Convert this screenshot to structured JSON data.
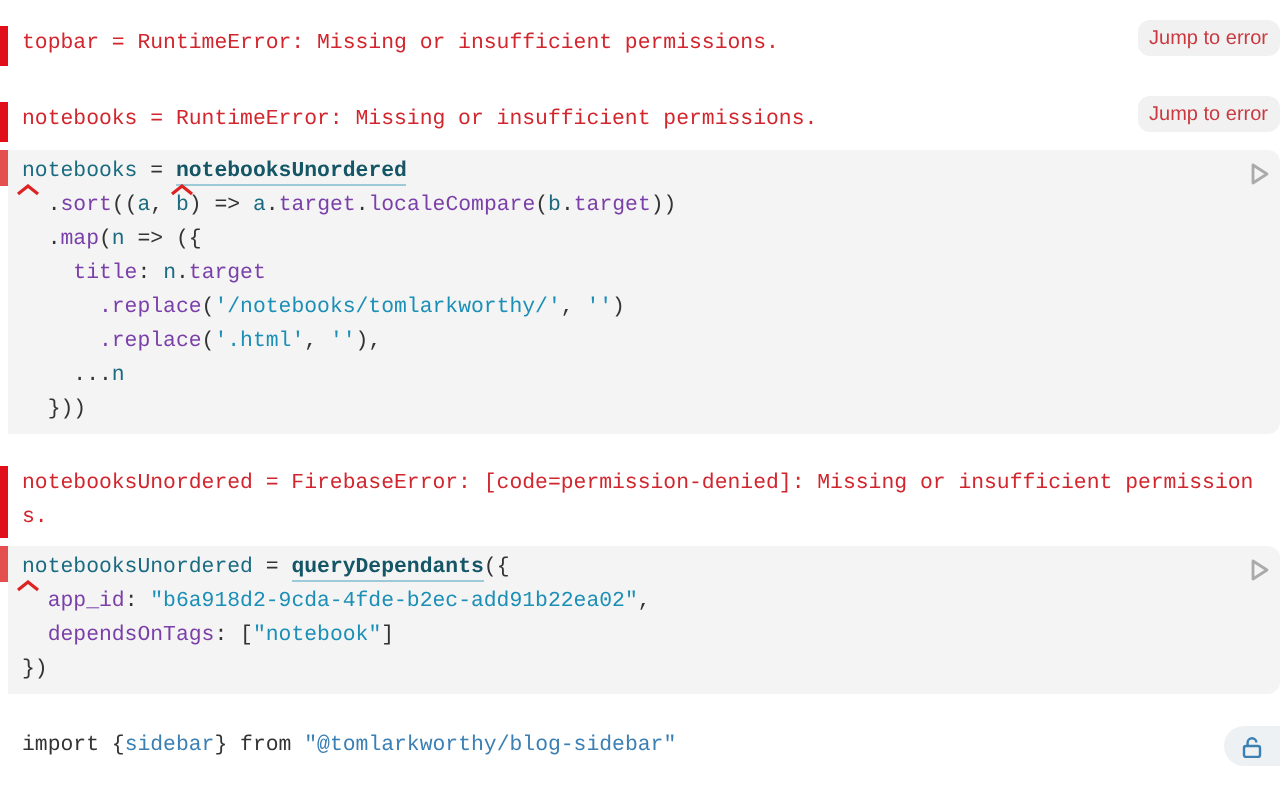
{
  "cells": [
    {
      "kind": "error",
      "text": "topbar = RuntimeError: Missing or insufficient permissions.",
      "button": "Jump to error"
    },
    {
      "kind": "error",
      "text": "notebooks = RuntimeError: Missing or insufficient permissions.",
      "button": "Jump to error"
    },
    {
      "kind": "code",
      "errored": true,
      "runnable": true,
      "lines": [
        [
          {
            "t": "notebooks",
            "kind": "def",
            "caret": true
          },
          {
            "t": " = ",
            "kind": "plain"
          },
          {
            "t": "notebooksUnordered",
            "kind": "link",
            "caret": true
          }
        ],
        [
          {
            "t": "  .",
            "kind": "plain"
          },
          {
            "t": "sort",
            "kind": "prop"
          },
          {
            "t": "((",
            "kind": "plain"
          },
          {
            "t": "a",
            "kind": "def"
          },
          {
            "t": ", ",
            "kind": "plain"
          },
          {
            "t": "b",
            "kind": "def"
          },
          {
            "t": ") => ",
            "kind": "plain"
          },
          {
            "t": "a",
            "kind": "def"
          },
          {
            "t": ".",
            "kind": "plain"
          },
          {
            "t": "target",
            "kind": "prop"
          },
          {
            "t": ".",
            "kind": "plain"
          },
          {
            "t": "localeCompare",
            "kind": "prop"
          },
          {
            "t": "(",
            "kind": "plain"
          },
          {
            "t": "b",
            "kind": "def"
          },
          {
            "t": ".",
            "kind": "plain"
          },
          {
            "t": "target",
            "kind": "prop"
          },
          {
            "t": "))",
            "kind": "plain"
          }
        ],
        [
          {
            "t": "  .",
            "kind": "plain"
          },
          {
            "t": "map",
            "kind": "prop"
          },
          {
            "t": "(",
            "kind": "plain"
          },
          {
            "t": "n",
            "kind": "def"
          },
          {
            "t": " => ({",
            "kind": "plain"
          }
        ],
        [
          {
            "t": "    title",
            "kind": "prop"
          },
          {
            "t": ": ",
            "kind": "plain"
          },
          {
            "t": "n",
            "kind": "def"
          },
          {
            "t": ".",
            "kind": "plain"
          },
          {
            "t": "target",
            "kind": "prop"
          }
        ],
        [
          {
            "t": "      .replace",
            "kind": "prop"
          },
          {
            "t": "(",
            "kind": "plain"
          },
          {
            "t": "'/notebooks/tomlarkworthy/'",
            "kind": "string"
          },
          {
            "t": ", ",
            "kind": "plain"
          },
          {
            "t": "''",
            "kind": "string"
          },
          {
            "t": ")",
            "kind": "plain"
          }
        ],
        [
          {
            "t": "      .replace",
            "kind": "prop"
          },
          {
            "t": "(",
            "kind": "plain"
          },
          {
            "t": "'.html'",
            "kind": "string"
          },
          {
            "t": ", ",
            "kind": "plain"
          },
          {
            "t": "''",
            "kind": "string"
          },
          {
            "t": "),",
            "kind": "plain"
          }
        ],
        [
          {
            "t": "    ...",
            "kind": "plain"
          },
          {
            "t": "n",
            "kind": "def"
          }
        ],
        [
          {
            "t": "  }))",
            "kind": "plain"
          }
        ]
      ]
    },
    {
      "kind": "error",
      "text": "notebooksUnordered = FirebaseError: [code=permission-denied]: Missing or insufficient permissions."
    },
    {
      "kind": "code",
      "errored": true,
      "runnable": true,
      "lines": [
        [
          {
            "t": "notebooksUnordered",
            "kind": "def",
            "caret": true
          },
          {
            "t": " = ",
            "kind": "plain"
          },
          {
            "t": "queryDependants",
            "kind": "link"
          },
          {
            "t": "({",
            "kind": "plain"
          }
        ],
        [
          {
            "t": "  app_id",
            "kind": "prop"
          },
          {
            "t": ": ",
            "kind": "plain"
          },
          {
            "t": "\"b6a918d2-9cda-4fde-b2ec-add91b22ea02\"",
            "kind": "string"
          },
          {
            "t": ",",
            "kind": "plain"
          }
        ],
        [
          {
            "t": "  dependsOnTags",
            "kind": "prop"
          },
          {
            "t": ": [",
            "kind": "plain"
          },
          {
            "t": "\"notebook\"",
            "kind": "string"
          },
          {
            "t": "]",
            "kind": "plain"
          }
        ],
        [
          {
            "t": "})",
            "kind": "plain"
          }
        ]
      ]
    },
    {
      "kind": "import",
      "locked": false,
      "lines": [
        [
          {
            "t": "import {",
            "kind": "plain"
          },
          {
            "t": "sidebar",
            "kind": "import"
          },
          {
            "t": "} from ",
            "kind": "plain"
          },
          {
            "t": "\"@tomlarkworthy/blog-sidebar\"",
            "kind": "import"
          }
        ]
      ]
    }
  ]
}
